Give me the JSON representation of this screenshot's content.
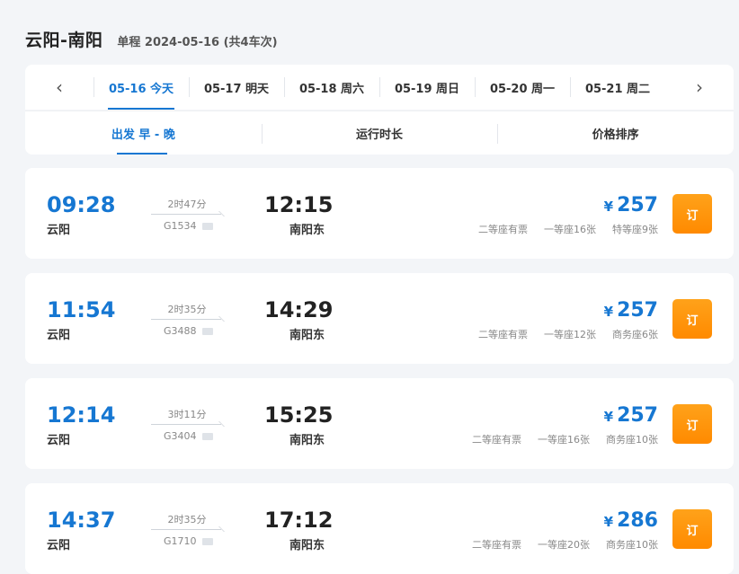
{
  "header": {
    "route": "云阳-南阳",
    "subinfo": "单程 2024-05-16 (共4车次)"
  },
  "dates": [
    "05-16 今天",
    "05-17 明天",
    "05-18 周六",
    "05-19 周日",
    "05-20 周一",
    "05-21 周二"
  ],
  "date_nav": {
    "prev": "‹",
    "next": "›"
  },
  "sort": [
    "出发 早 - 晚",
    "运行时长",
    "价格排序"
  ],
  "book_label": "订",
  "currency": "¥",
  "colors": {
    "accent": "#1677d2",
    "book": "#ff8a00"
  },
  "trains": [
    {
      "dep_time": "09:28",
      "dep_station": "云阳",
      "duration": "2时47分",
      "train_no": "G1534",
      "arr_time": "12:15",
      "arr_station": "南阳东",
      "price": "257",
      "seat1": "二等座有票",
      "seat2": "一等座16张",
      "seat3": "特等座9张"
    },
    {
      "dep_time": "11:54",
      "dep_station": "云阳",
      "duration": "2时35分",
      "train_no": "G3488",
      "arr_time": "14:29",
      "arr_station": "南阳东",
      "price": "257",
      "seat1": "二等座有票",
      "seat2": "一等座12张",
      "seat3": "商务座6张"
    },
    {
      "dep_time": "12:14",
      "dep_station": "云阳",
      "duration": "3时11分",
      "train_no": "G3404",
      "arr_time": "15:25",
      "arr_station": "南阳东",
      "price": "257",
      "seat1": "二等座有票",
      "seat2": "一等座16张",
      "seat3": "商务座10张"
    },
    {
      "dep_time": "14:37",
      "dep_station": "云阳",
      "duration": "2时35分",
      "train_no": "G1710",
      "arr_time": "17:12",
      "arr_station": "南阳东",
      "price": "286",
      "seat1": "二等座有票",
      "seat2": "一等座20张",
      "seat3": "商务座10张"
    }
  ]
}
